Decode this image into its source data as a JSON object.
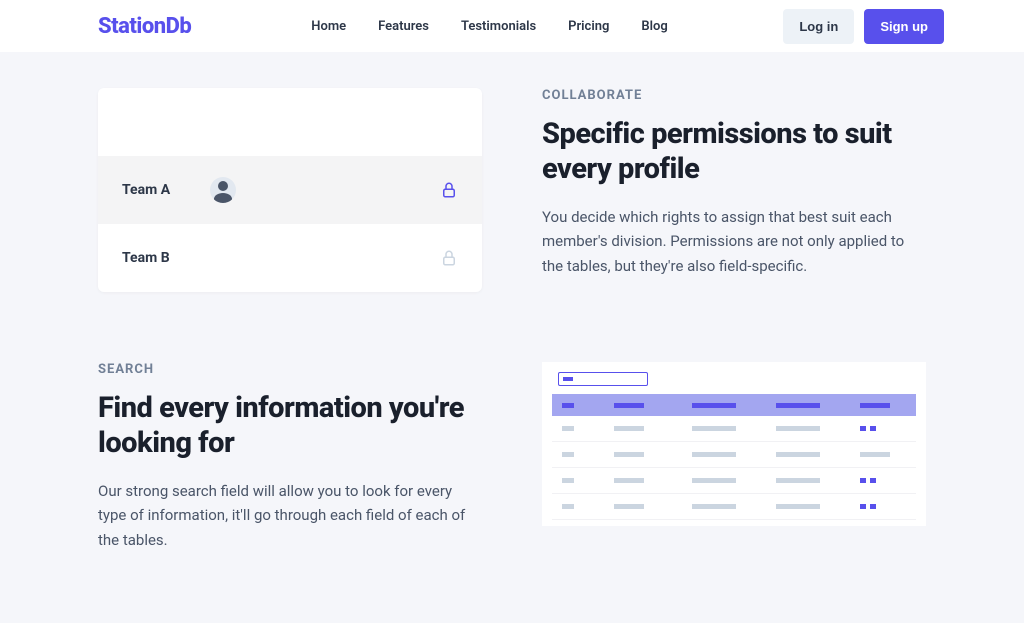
{
  "brand": "StationDb",
  "nav": {
    "home": "Home",
    "features": "Features",
    "testimonials": "Testimonials",
    "pricing": "Pricing",
    "blog": "Blog"
  },
  "actions": {
    "login": "Log in",
    "signup": "Sign up"
  },
  "collaborate": {
    "eyebrow": "COLLABORATE",
    "headline": "Specific permissions to suit every profile",
    "body": "You decide which rights to assign that best suit each member's division. Permissions are not only applied to the tables, but they're also field-specific.",
    "teams": {
      "a": "Team A",
      "b": "Team B"
    }
  },
  "search": {
    "eyebrow": "SEARCH",
    "headline": "Find every information you're looking for",
    "body": "Our strong search field will allow you to look for every type of information, it'll go through each field of each of the tables."
  },
  "colors": {
    "accent": "#5850ec"
  }
}
